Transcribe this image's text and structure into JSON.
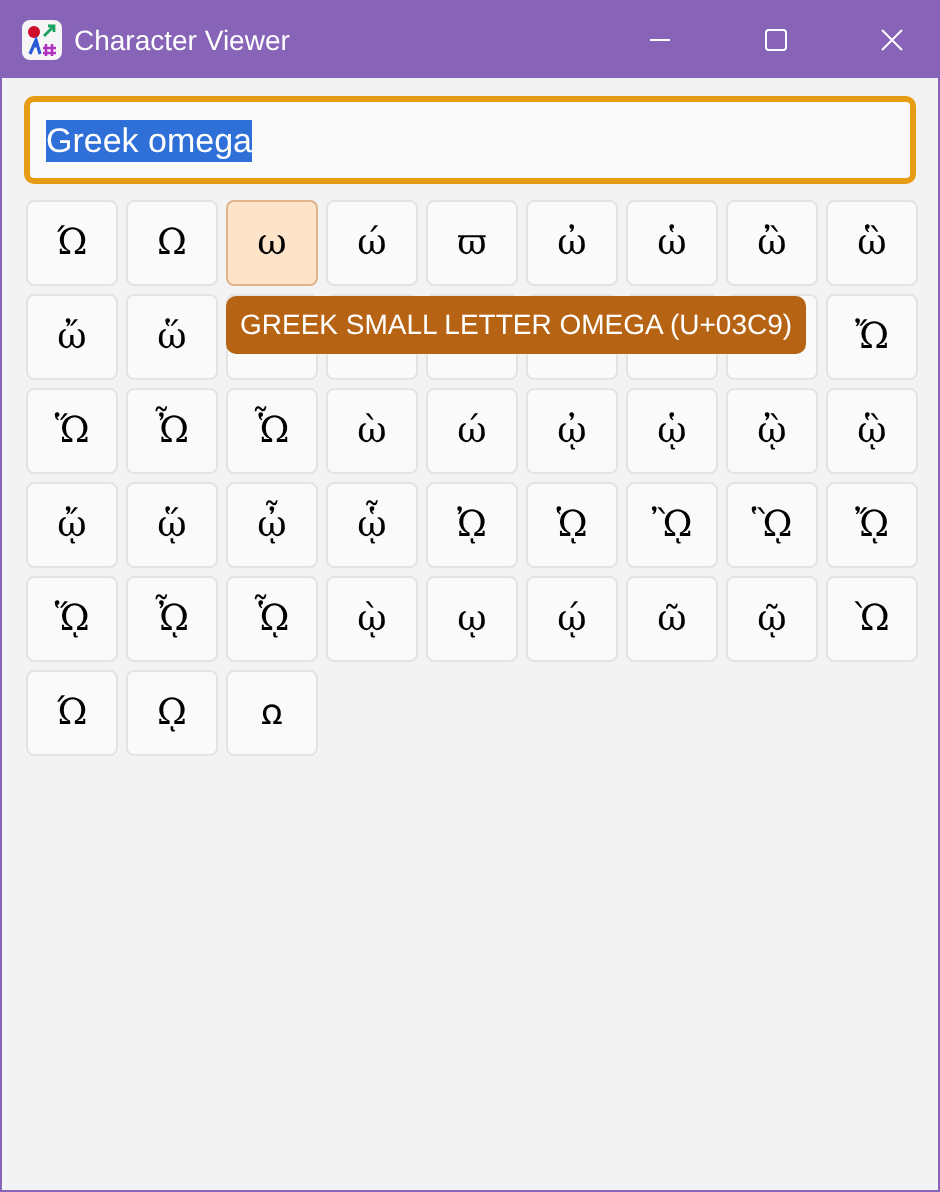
{
  "window": {
    "title": "Character Viewer"
  },
  "search": {
    "value": "Greek omega",
    "text_selected": true
  },
  "characters": [
    {
      "char": "Ώ",
      "selected": false
    },
    {
      "char": "Ω",
      "selected": false
    },
    {
      "char": "ω",
      "selected": true
    },
    {
      "char": "ώ",
      "selected": false
    },
    {
      "char": "ϖ",
      "selected": false
    },
    {
      "char": "ὠ",
      "selected": false
    },
    {
      "char": "ὡ",
      "selected": false
    },
    {
      "char": "ὢ",
      "selected": false
    },
    {
      "char": "ὣ",
      "selected": false
    },
    {
      "char": "ὤ",
      "selected": false
    },
    {
      "char": "ὥ",
      "selected": false
    },
    {
      "selected": false
    },
    {
      "selected": false
    },
    {
      "selected": false
    },
    {
      "selected": false
    },
    {
      "selected": false
    },
    {
      "selected": false
    },
    {
      "char": "Ὤ",
      "selected": false
    },
    {
      "char": "Ὥ",
      "selected": false
    },
    {
      "char": "Ὦ",
      "selected": false
    },
    {
      "char": "Ὧ",
      "selected": false
    },
    {
      "char": "ὼ",
      "selected": false
    },
    {
      "char": "ώ",
      "selected": false
    },
    {
      "char": "ᾠ",
      "selected": false
    },
    {
      "char": "ᾡ",
      "selected": false
    },
    {
      "char": "ᾢ",
      "selected": false
    },
    {
      "char": "ᾣ",
      "selected": false
    },
    {
      "char": "ᾤ",
      "selected": false
    },
    {
      "char": "ᾥ",
      "selected": false
    },
    {
      "char": "ᾦ",
      "selected": false
    },
    {
      "char": "ᾧ",
      "selected": false
    },
    {
      "char": "ᾨ",
      "selected": false
    },
    {
      "char": "ᾩ",
      "selected": false
    },
    {
      "char": "ᾪ",
      "selected": false
    },
    {
      "char": "ᾫ",
      "selected": false
    },
    {
      "char": "ᾬ",
      "selected": false
    },
    {
      "char": "ᾭ",
      "selected": false
    },
    {
      "char": "ᾮ",
      "selected": false
    },
    {
      "char": "ᾯ",
      "selected": false
    },
    {
      "char": "ῲ",
      "selected": false
    },
    {
      "char": "ῳ",
      "selected": false
    },
    {
      "char": "ῴ",
      "selected": false
    },
    {
      "char": "ῶ",
      "selected": false
    },
    {
      "char": "ῷ",
      "selected": false
    },
    {
      "char": "Ὼ",
      "selected": false
    },
    {
      "char": "Ώ",
      "selected": false
    },
    {
      "char": "ῼ",
      "selected": false
    },
    {
      "char": "ꭥ",
      "selected": false
    }
  ],
  "tooltip": {
    "text": "GREEK SMALL LETTER OMEGA (U+03C9)"
  }
}
